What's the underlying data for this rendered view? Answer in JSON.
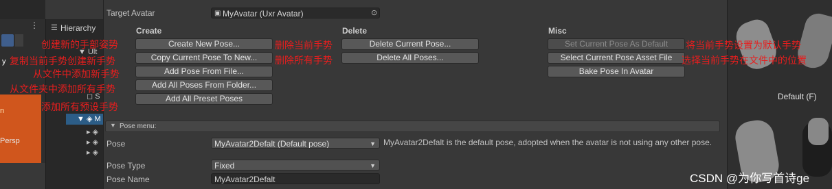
{
  "scene": {
    "gizmo_label": "y",
    "persp_label": "Persp",
    "partial_label": "n"
  },
  "hierarchy": {
    "title": "Hierarchy",
    "rows": [
      "Ult",
      "S",
      "M"
    ]
  },
  "inspector": {
    "target_avatar_label": "Target Avatar",
    "target_avatar_value": "MyAvatar (Uxr Avatar)",
    "create": {
      "header": "Create",
      "buttons": [
        "Create New Pose...",
        "Copy Current Pose To New...",
        "Add Pose From File...",
        "Add All Poses From Folder...",
        "Add All Preset Poses"
      ]
    },
    "delete": {
      "header": "Delete",
      "buttons": [
        "Delete Current Pose...",
        "Delete All Poses..."
      ]
    },
    "misc": {
      "header": "Misc",
      "buttons": [
        "Set Current Pose As Default",
        "Select Current Pose Asset File",
        "Bake Pose In Avatar"
      ]
    },
    "pose_menu": {
      "header": "Pose menu:",
      "pose_label": "Pose",
      "pose_value": "MyAvatar2Defalt (Default pose)",
      "pose_note": "MyAvatar2Defalt is the default pose, adopted when the avatar is not using any other pose.",
      "pose_type_label": "Pose Type",
      "pose_type_value": "Fixed",
      "pose_name_label": "Pose Name",
      "pose_name_value": "MyAvatar2Defalt"
    }
  },
  "annotations": {
    "create_new": "创建新的手部姿势",
    "copy_current": "复制当前手势创建新手势",
    "add_from_file": "从文件中添加新手势",
    "add_from_folder": "从文件夹中添加所有手势",
    "add_presets": "添加所有预设手势",
    "delete_current": "删除当前手势",
    "delete_all": "删除所有手势",
    "set_default": "将当前手势设置为默认手势",
    "select_asset": "选择当前手势在文件中的位置"
  },
  "preview": {
    "caption": "Default (F)"
  },
  "watermark": "CSDN @为你写首诗ge",
  "colors": {
    "annotation": "#e61e1e",
    "selection": "#2c5d87",
    "orange_object": "#d0561d"
  }
}
